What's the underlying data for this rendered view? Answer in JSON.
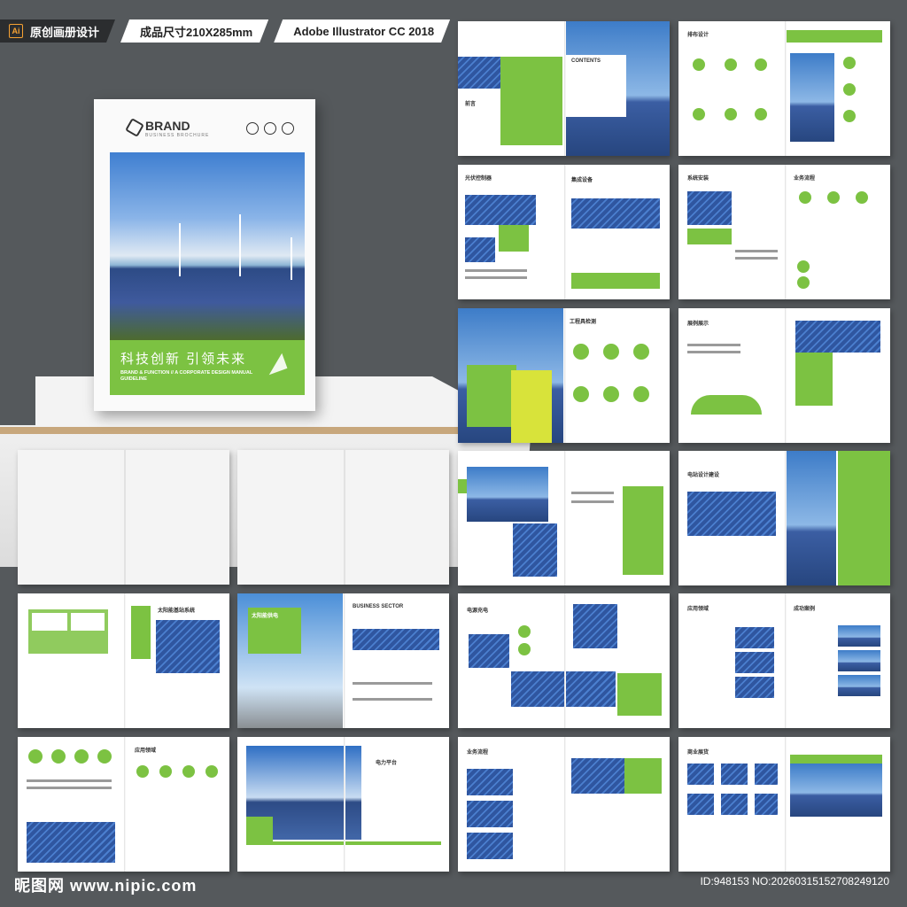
{
  "header": {
    "ai_badge": "Ai",
    "title": "原创画册设计",
    "size": "成品尺寸210X285mm",
    "software": "Adobe Illustrator CC 2018"
  },
  "cover": {
    "brand": "BRAND",
    "brand_sub": "BUSINESS BROCHURE",
    "slogan": "科技创新  引领未来",
    "slogan_sub": "BRAND & FUNCTION // A CORPORATE DESIGN MANUAL GUIDELINE"
  },
  "spreads": [
    {
      "id": "s1",
      "title": "前言",
      "title2": "CONTENTS"
    },
    {
      "id": "s2",
      "title": "排布设计",
      "title2": ""
    },
    {
      "id": "s3",
      "title": "光伏控制器",
      "title2": "集成设备"
    },
    {
      "id": "s4",
      "title": "系统安装",
      "title2": "业务流程"
    },
    {
      "id": "s5",
      "title": "",
      "title2": "工程具检测"
    },
    {
      "id": "s6",
      "title": "展例展示",
      "title2": ""
    },
    {
      "id": "s7",
      "title": "",
      "title2": ""
    },
    {
      "id": "s8",
      "title": "电站设计建设",
      "title2": ""
    },
    {
      "id": "s9",
      "title": "",
      "title2": "太阳能基站系统"
    },
    {
      "id": "s10",
      "title": "太阳能供电",
      "title2": "BUSINESS SECTOR"
    },
    {
      "id": "s11",
      "title": "电源充电",
      "title2": ""
    },
    {
      "id": "s12",
      "title": "应用领域",
      "title2": "成功案例"
    },
    {
      "id": "s13",
      "title": "",
      "title2": "应用领域"
    },
    {
      "id": "s14",
      "title": "",
      "title2": "电力平台"
    },
    {
      "id": "s15",
      "title": "业务流程",
      "title2": ""
    },
    {
      "id": "s16",
      "title": "商业展货",
      "title2": ""
    }
  ],
  "watermark": {
    "left": "昵图网 www.nipic.com",
    "right": "ID:948153 NO:20260315152708249120"
  }
}
